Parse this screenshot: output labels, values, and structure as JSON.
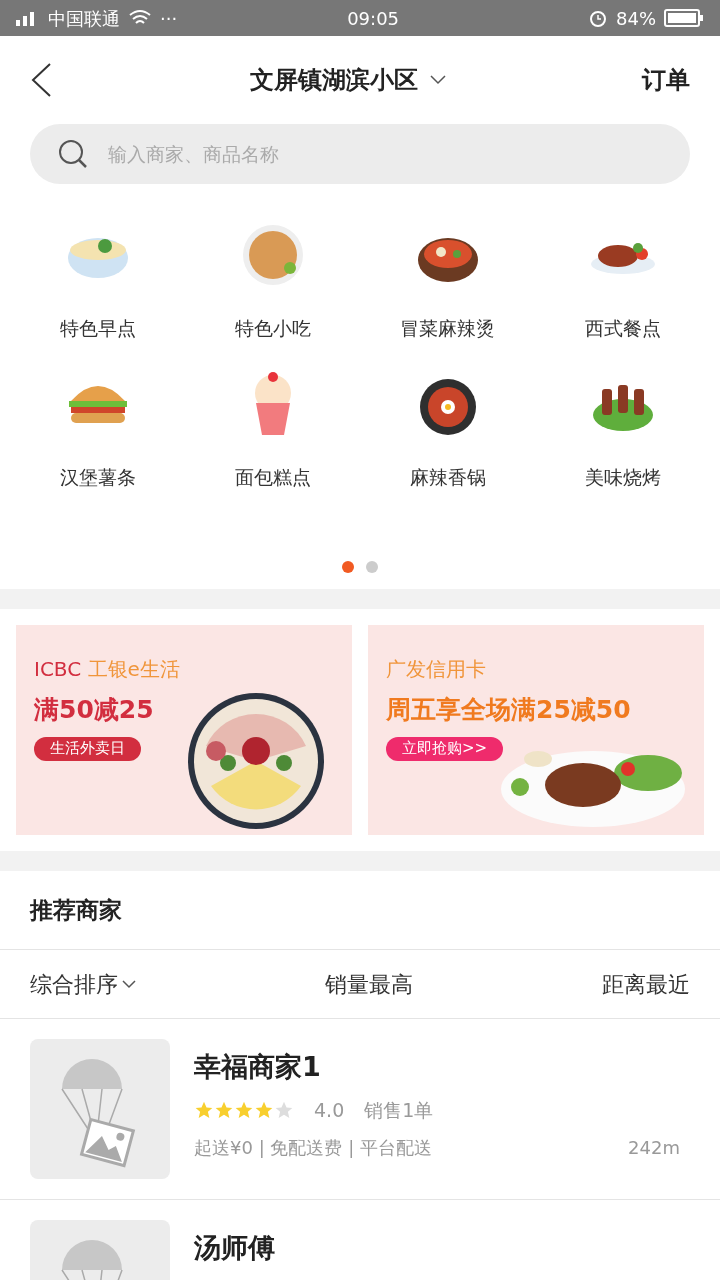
{
  "status_bar": {
    "carrier": "中国联通",
    "dots": "···",
    "time": "09:05",
    "battery": "84%"
  },
  "header": {
    "location": "文屏镇湖滨小区",
    "orders": "订单"
  },
  "search": {
    "placeholder": "输入商家、商品名称"
  },
  "categories": [
    {
      "label": "特色早点",
      "kind": "noodles"
    },
    {
      "label": "特色小吃",
      "kind": "pancake"
    },
    {
      "label": "冒菜麻辣烫",
      "kind": "pot"
    },
    {
      "label": "西式餐点",
      "kind": "steak"
    },
    {
      "label": "汉堡薯条",
      "kind": "burger"
    },
    {
      "label": "面包糕点",
      "kind": "cupcake"
    },
    {
      "label": "麻辣香锅",
      "kind": "wok"
    },
    {
      "label": "美味烧烤",
      "kind": "skewer"
    }
  ],
  "pager": [
    {
      "selected": true
    },
    {
      "selected": false
    }
  ],
  "banners": [
    {
      "brand": "ICBC",
      "title": " 工银e生活",
      "offer": "满50减25",
      "button": "生活外卖日",
      "kind": "platter"
    },
    {
      "title": "广发信用卡",
      "offer": "周五享全场满25减50",
      "button": "立即抢购>>",
      "kind": "steak"
    }
  ],
  "section_title": "推荐商家",
  "sort_tabs": [
    {
      "label": "综合排序",
      "dropdown": true
    },
    {
      "label": "销量最高",
      "dropdown": false
    },
    {
      "label": "距离最近",
      "dropdown": false
    }
  ],
  "merchants": [
    {
      "name": "幸福商家1",
      "stars": 4,
      "rating": "4.0",
      "sales": "销售1单",
      "info": "起送¥0 | 免配送费 | 平台配送",
      "distance": "242m"
    },
    {
      "name": "汤师傅"
    }
  ]
}
